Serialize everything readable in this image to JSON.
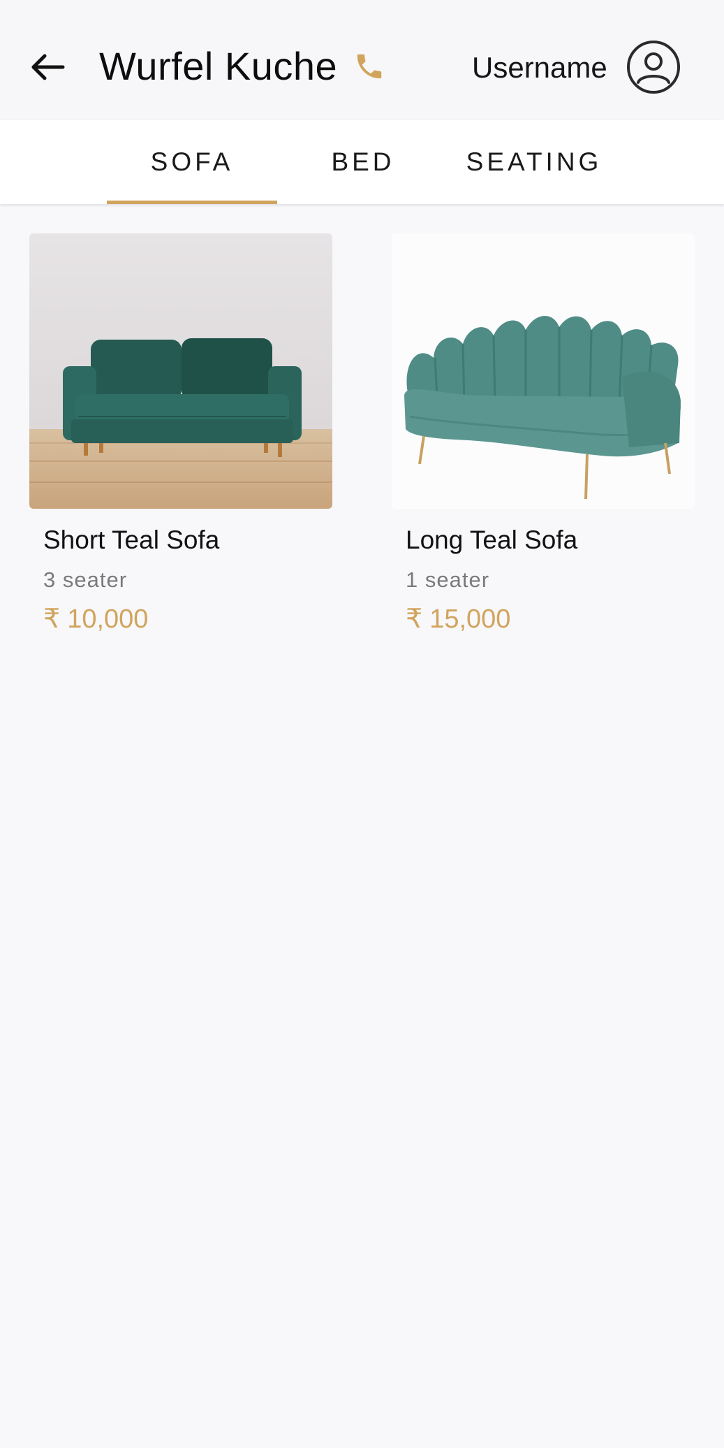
{
  "header": {
    "title": "Wurfel Kuche",
    "username": "Username",
    "icons": {
      "back": "arrow-left-icon",
      "phone": "phone-icon",
      "avatar": "user-circle-icon"
    }
  },
  "tabs": [
    {
      "label": "SOFA",
      "active": true
    },
    {
      "label": "BED",
      "active": false
    },
    {
      "label": "SEATING",
      "active": false
    }
  ],
  "products": [
    {
      "name": "Short Teal Sofa",
      "subtitle": "3 seater",
      "currency": "₹",
      "price": "10,000"
    },
    {
      "name": "Long Teal Sofa",
      "subtitle": "1 seater",
      "currency": "₹",
      "price": "15,000"
    }
  ],
  "colors": {
    "accent": "#d1a45d",
    "background": "#f8f8fb",
    "teal": "#2f6b62"
  }
}
